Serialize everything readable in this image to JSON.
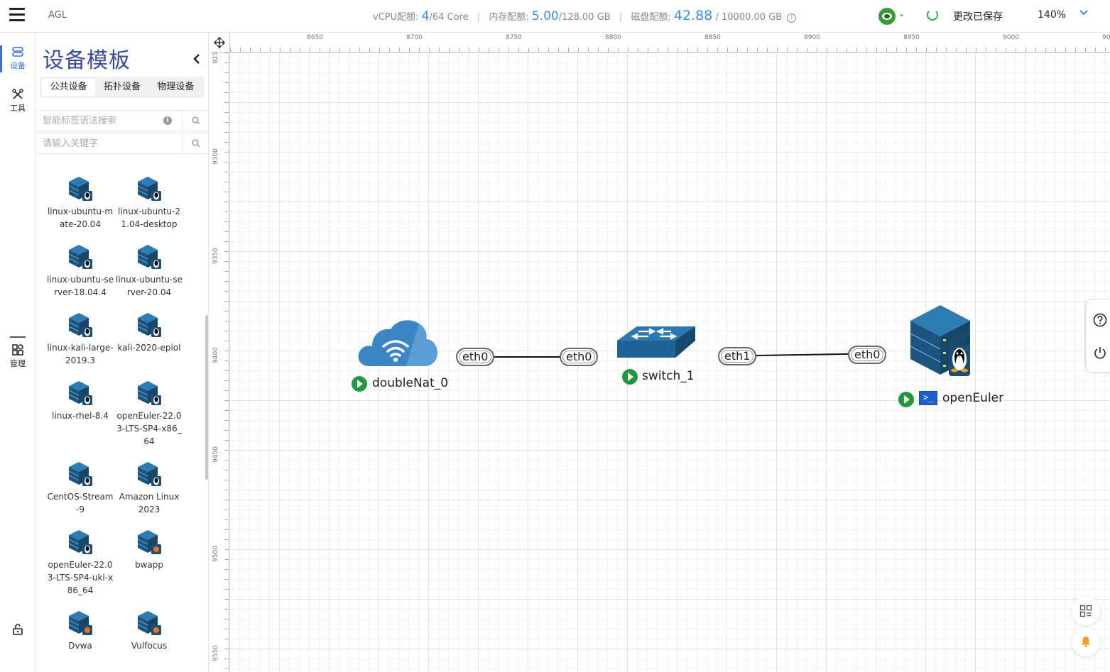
{
  "header": {
    "app_title": "AGL",
    "vcpu_label": "vCPU配额:",
    "vcpu_used": "4",
    "vcpu_total": "/64 Core",
    "mem_label": "内存配额:",
    "mem_used": "5.00",
    "mem_total": "/128.00 GB",
    "disk_label": "磁盘配额:",
    "disk_used": "42.88",
    "disk_total": "/ 10000.00 GB",
    "save_status": "更改已保存",
    "zoom": "140%"
  },
  "rail": {
    "devices": "设备",
    "tools": "工具",
    "manage": "管理"
  },
  "panel": {
    "title": "设备模板",
    "tabs": [
      "公共设备",
      "拓扑设备",
      "物理设备"
    ],
    "smart_search_placeholder": "智能标签语法搜索",
    "keyword_placeholder": "请输入关键字",
    "devices": [
      "linux-ubuntu-mate-20.04",
      "linux-ubuntu-21.04-desktop",
      "linux-ubuntu-server-18.04.4",
      "linux-ubuntu-server-20.04",
      "linux-kali-large-2019.3",
      "kali-2020-epiol",
      "linux-rhel-8.4",
      "openEuler-22.03-LTS-SP4-x86_64",
      "CentOS-Stream-9",
      "Amazon Linux 2023",
      "openEuler-22.03-LTS-SP4-uki-x86_64",
      "bwapp",
      "Dvwa",
      "Vulfocus"
    ]
  },
  "ruler": {
    "top": [
      "8650",
      "8700",
      "8750",
      "8800",
      "8850",
      "8900",
      "8950",
      "9000",
      "90"
    ],
    "left": [
      "925",
      "9300",
      "9350",
      "9400",
      "9450",
      "9500",
      "9550"
    ]
  },
  "topology": {
    "nodes": {
      "nat": "doubleNat_0",
      "switch": "switch_1",
      "server": "openEuler"
    },
    "ports": {
      "nat_eth0": "eth0",
      "switch_eth0": "eth0",
      "switch_eth1": "eth1",
      "server_eth0": "eth0"
    }
  },
  "colors": {
    "accent": "#3a6fd8",
    "title": "#3b4aa0",
    "quota_value": "#3a8ee6",
    "run": "#1f9a3a",
    "server": "#1f5f8b"
  }
}
